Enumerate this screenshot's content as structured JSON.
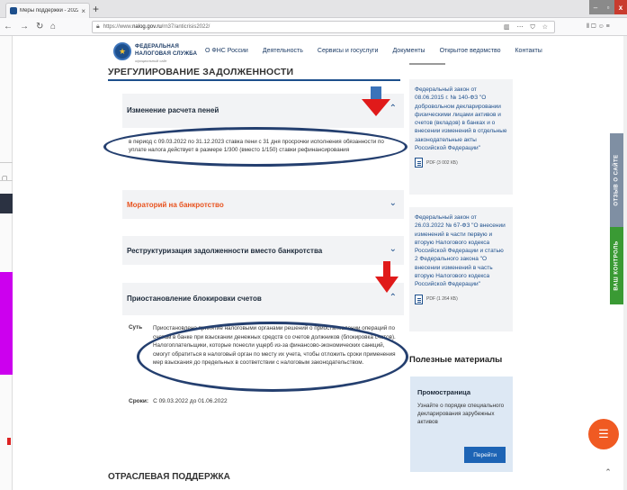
{
  "browser": {
    "tab_title": "Меры поддержки - 2022 | ФНС",
    "tab_close": "×",
    "new_tab": "+",
    "url_prefix": "https://www.",
    "url_domain": "nalog.gov.ru",
    "url_path": "/rn37/anticrisis2022/",
    "url_icons": "▥ ⋯ ⛉ ☆",
    "toolbar_icons": "⦀ ▢ ☺ ≡",
    "window_min": "–",
    "window_max": "▫",
    "window_close": "x"
  },
  "site": {
    "logo_line1": "ФЕДЕРАЛЬНАЯ",
    "logo_line2": "НАЛОГОВАЯ СЛУЖБА",
    "logo_line3": "официальный сайт",
    "nav": [
      "О ФНС России",
      "Деятельность",
      "Сервисы и госуслуги",
      "Документы",
      "Открытое ведомство",
      "Контакты"
    ]
  },
  "main": {
    "title": "УРЕГУЛИРОВАНИЕ ЗАДОЛЖЕННОСТИ",
    "accordion": [
      {
        "title": "Изменение расчета пеней",
        "text": "в период с 09.03.2022 по 31.12.2023 ставка пени с 31 дня просрочки исполнения обязанности по уплате налога действует в размере 1/300 (вместо 1/150) ставки рефинансирования"
      },
      {
        "title": "Мораторий на банкротство"
      },
      {
        "title": "Реструктуризация задолженности вместо банкротства"
      },
      {
        "title": "Приостановление блокировки счетов",
        "side_label": "Суть",
        "text": "Приостановлено принятие налоговыми органами решений о приостановлении операций по счетам в банке при взыскании денежных средств со счетов должников (блокировка счетов). Налогоплательщики, которые понесли ущерб из-за финансово-экономических санкций, смогут обратиться в налоговый орган по месту их учета, чтобы отложить сроки применения мер взыскания до предельных в соответствии с налоговым законодательством.",
        "dates_label": "Сроки:",
        "dates_value": "С 09.03.2022 до 01.06.2022"
      }
    ],
    "section2_title": "ОТРАСЛЕВАЯ ПОДДЕРЖКА"
  },
  "sidebar": {
    "docs": [
      {
        "text": "Федеральный закон от 08.06.2015 г. № 140-ФЗ \"О добровольном декларировании физическими лицами активов и счетов (вкладов) в банках и о внесении изменений в отдельные законодательные акты Российской Федерации\"",
        "file": "PDF (3 002 КБ)"
      },
      {
        "text": "Федеральный закон от 26.03.2022 № 67-ФЗ \"О внесении изменений в части первую и вторую Налогового кодекса Российской Федерации и статью 2 Федерального закона \"О внесении изменений в часть вторую Налогового кодекса Российской Федерации\"",
        "file": "PDF (1 264 КБ)"
      }
    ],
    "useful_title": "Полезные материалы",
    "promo": {
      "title": "Промостраница",
      "text": "Узнайте о порядке специального декларирования зарубежных активов",
      "button": "Перейти"
    }
  },
  "widgets": {
    "feedback_tab": "ОТЗЫВ О САЙТЕ",
    "control_tab": "ВАШ КОНТРОЛЬ"
  },
  "colors": {
    "brand": "#1d4f8c",
    "accent_orange": "#e8531f",
    "annotation_red": "#e01a1a",
    "annotation_oval": "#243f6f",
    "control_green": "#3a9a34"
  }
}
